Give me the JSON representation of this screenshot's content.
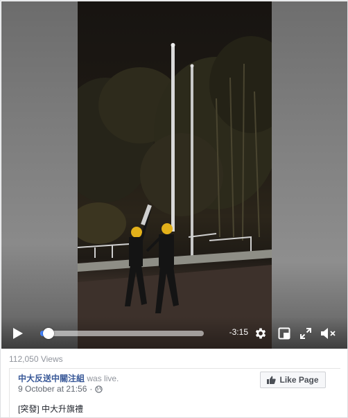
{
  "video": {
    "time_remaining": "-3:15",
    "progress_fraction": 0.052,
    "accent_color": "#4080ff",
    "icons": [
      "play-icon",
      "gear-icon",
      "picture-in-picture-icon",
      "fullscreen-icon",
      "muted-speaker-icon"
    ]
  },
  "post": {
    "views": "112,050 Views",
    "page_name": "中大反送中關注組",
    "status_text": "was live.",
    "timestamp": "9 October at 21:56",
    "privacy_icon": "globe-icon",
    "like_page_label": "Like Page",
    "caption": "[突發] 中大升旗禮",
    "link_color": "#385898"
  }
}
